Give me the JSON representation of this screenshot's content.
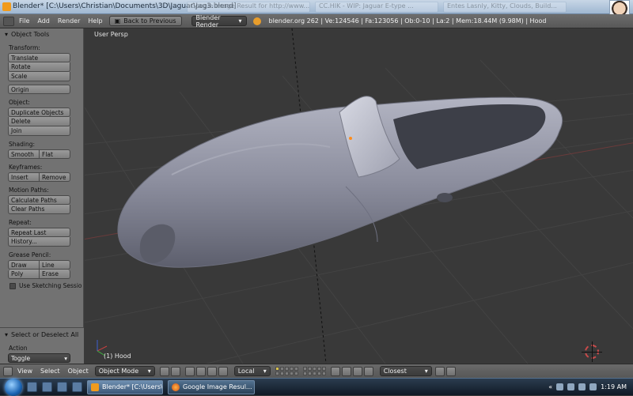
{
  "window": {
    "title": "Blender* [C:\\Users\\Christian\\Documents\\3D\\Jaguar\\Jag3.blend]",
    "background_tabs": [
      "Google Image Result for http://www...",
      "CC.HIK - WIP: Jaguar E-type ...",
      "Entes Lasnly, Kitty, Clouds, Build..."
    ]
  },
  "header": {
    "menus": [
      "File",
      "Add",
      "Render",
      "Help"
    ],
    "back_button": "Back to Previous",
    "render_engine": "Blender Render",
    "stats": "blender.org 262 | Ve:124546 | Fa:123056 | Ob:0-10 | La:2 | Mem:18.44M (9.98M) | Hood"
  },
  "tool_panel": {
    "title": "Object Tools",
    "sections": {
      "transform": {
        "label": "Transform:",
        "buttons": [
          "Translate",
          "Rotate",
          "Scale"
        ],
        "origin": "Origin"
      },
      "object": {
        "label": "Object:",
        "buttons": [
          "Duplicate Objects",
          "Delete",
          "Join"
        ]
      },
      "shading": {
        "label": "Shading:",
        "buttons": [
          "Smooth",
          "Flat"
        ]
      },
      "keyframes": {
        "label": "Keyframes:",
        "buttons": [
          "Insert",
          "Remove"
        ]
      },
      "motion_paths": {
        "label": "Motion Paths:",
        "buttons": [
          "Calculate Paths",
          "Clear Paths"
        ]
      },
      "repeat": {
        "label": "Repeat:",
        "buttons": [
          "Repeat Last",
          "History..."
        ]
      },
      "grease_pencil": {
        "label": "Grease Pencil:",
        "buttons": [
          "Draw",
          "Line",
          "Poly",
          "Erase"
        ],
        "checkbox": "Use Sketching Sessio"
      }
    }
  },
  "operator_panel": {
    "title": "Select or Deselect All",
    "action_label": "Action",
    "action_value": "Toggle"
  },
  "viewport": {
    "view_label": "User Persp",
    "object_label": "(1) Hood"
  },
  "view_header": {
    "menus": [
      "View",
      "Select",
      "Object"
    ],
    "mode": "Object Mode",
    "orientation": "Local",
    "snap": "Closest"
  },
  "taskbar": {
    "tasks": [
      "Blender* [C:\\Users\\...",
      "Google Image Resul..."
    ],
    "clock": "1:19 AM"
  },
  "colors": {
    "viewport_bg": "#393939",
    "panel_bg": "#727272",
    "car_body": "#8d8fa0"
  }
}
